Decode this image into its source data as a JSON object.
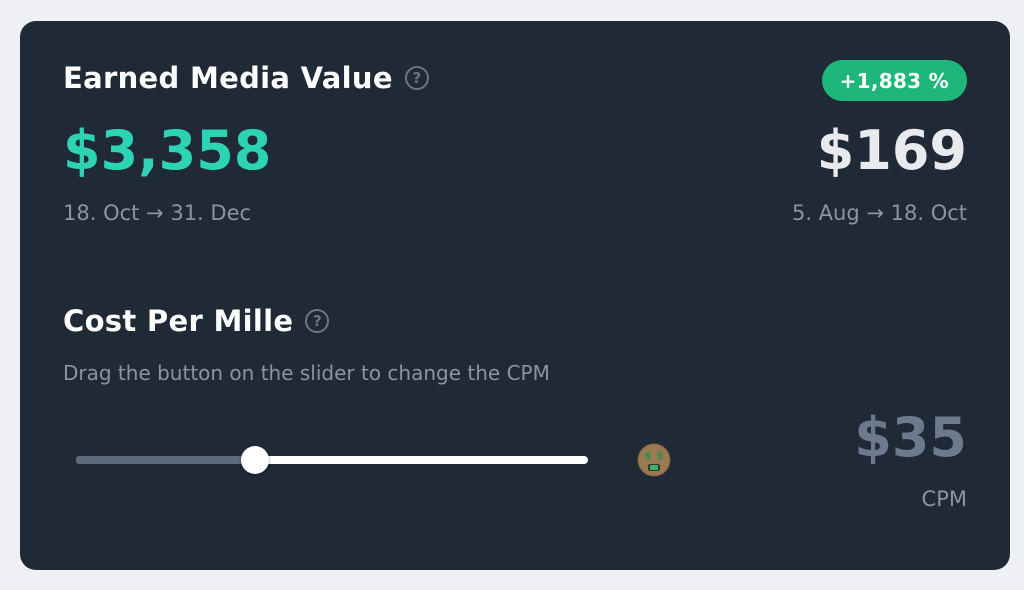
{
  "emv": {
    "title": "Earned Media Value",
    "help_glyph": "?",
    "change_badge": "+1,883 %",
    "current_value": "$3,358",
    "current_range": "18. Oct → 31. Dec",
    "previous_value": "$169",
    "previous_range": "5. Aug → 18. Oct"
  },
  "cpm": {
    "title": "Cost Per Mille",
    "help_glyph": "?",
    "subtitle": "Drag the button on the slider to change the CPM",
    "slider_fraction": 0.35,
    "value": "$35",
    "unit": "CPM",
    "emoji_icon": "money-mouth-face-icon"
  },
  "colors": {
    "accent_teal": "#2dd4b3",
    "badge_green": "#1eb67a",
    "card_bg": "#202a37"
  }
}
